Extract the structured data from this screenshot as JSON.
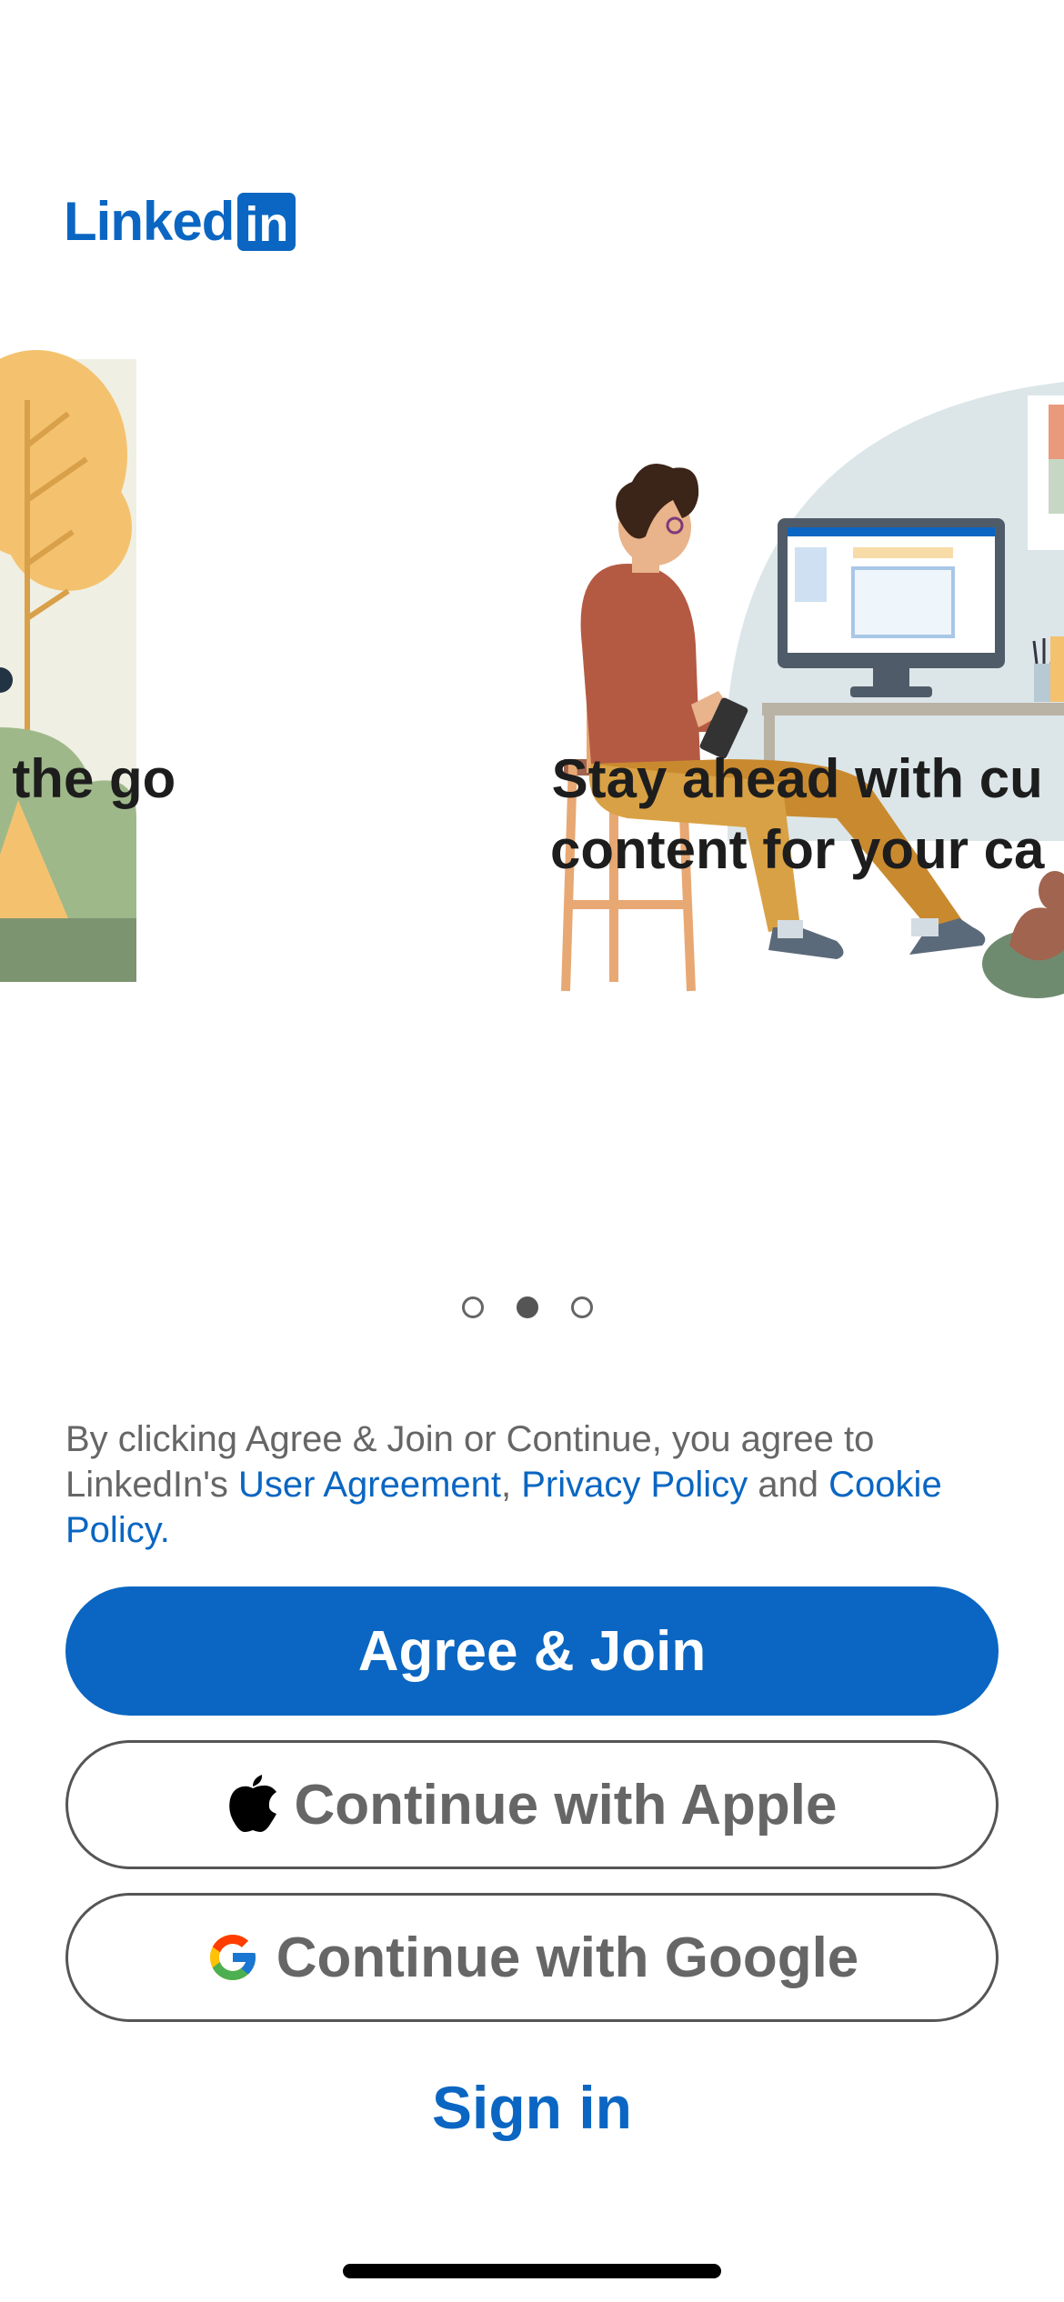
{
  "brand": {
    "logo_text": "Linked",
    "logo_box_text": "in",
    "color": "#0a66c2"
  },
  "carousel": {
    "slides": [
      {
        "caption_line1": "n the go"
      },
      {
        "caption_line1": "Stay ahead with cu",
        "caption_line2": "content for your ca"
      }
    ],
    "page_count": 3,
    "active_page": 2
  },
  "legal": {
    "prefix": "By clicking Agree & Join or Continue, you agree to LinkedIn's ",
    "user_agreement": "User Agreement",
    "comma": ", ",
    "privacy_policy": "Privacy Policy",
    "and": " and ",
    "cookie_policy": "Cookie Policy",
    "period": "."
  },
  "buttons": {
    "agree_join": "Agree & Join",
    "apple": "Continue with Apple",
    "google": "Continue with Google",
    "sign_in": "Sign in"
  },
  "icons": {
    "apple": "apple-icon",
    "google": "google-icon"
  }
}
